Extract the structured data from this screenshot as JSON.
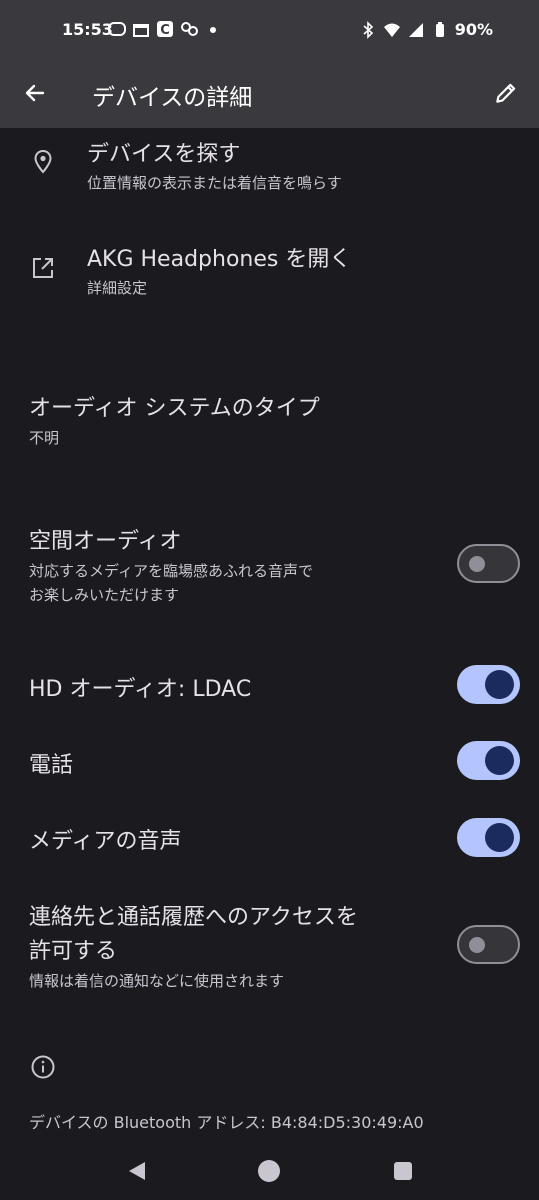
{
  "status_bar": {
    "time": "15:53",
    "battery": "90%"
  },
  "app_bar": {
    "title": "デバイスの詳細"
  },
  "find_device": {
    "title": "デバイスを探す",
    "subtitle": "位置情報の表示または着信音を鳴らす"
  },
  "open_app": {
    "title": "AKG Headphones を開く",
    "subtitle": "詳細設定"
  },
  "audio_type": {
    "label": "オーディオ システムのタイプ",
    "value": "不明"
  },
  "spatial_audio": {
    "label": "空間オーディオ",
    "desc_line1": "対応するメディアを臨場感あふれる音声で",
    "desc_line2": "お楽しみいただけます",
    "enabled": false
  },
  "hd_audio": {
    "label": "HD オーディオ: LDAC",
    "enabled": true
  },
  "phone": {
    "label": "電話",
    "enabled": true
  },
  "media_audio": {
    "label": "メディアの音声",
    "enabled": true
  },
  "contacts_access": {
    "label_line1": "連絡先と通話履歴へのアクセスを",
    "label_line2": "許可する",
    "desc": "情報は着信の通知などに使用されます",
    "enabled": false
  },
  "bluetooth_address": "デバイスの Bluetooth アドレス: B4:84:D5:30:49:A0",
  "colors": {
    "accent": "#b3c5fc",
    "knob_on": "#1c2b5e",
    "background": "#1b1b1f",
    "app_bar": "#3a393e"
  }
}
